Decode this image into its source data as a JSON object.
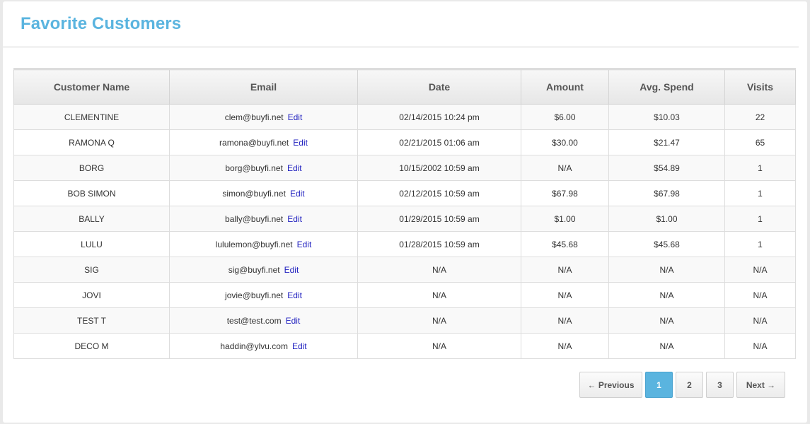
{
  "header": {
    "title": "Favorite Customers"
  },
  "table": {
    "columns": [
      "Customer Name",
      "Email",
      "Date",
      "Amount",
      "Avg. Spend",
      "Visits"
    ],
    "edit_label": "Edit",
    "rows": [
      {
        "name": "CLEMENTINE",
        "email": "clem@buyfi.net",
        "date": "02/14/2015 10:24 pm",
        "amount": "$6.00",
        "avg": "$10.03",
        "visits": "22"
      },
      {
        "name": "RAMONA Q",
        "email": "ramona@buyfi.net",
        "date": "02/21/2015 01:06 am",
        "amount": "$30.00",
        "avg": "$21.47",
        "visits": "65"
      },
      {
        "name": "BORG",
        "email": "borg@buyfi.net",
        "date": "10/15/2002 10:59 am",
        "amount": "N/A",
        "avg": "$54.89",
        "visits": "1"
      },
      {
        "name": "BOB SIMON",
        "email": "simon@buyfi.net",
        "date": "02/12/2015 10:59 am",
        "amount": "$67.98",
        "avg": "$67.98",
        "visits": "1"
      },
      {
        "name": "BALLY",
        "email": "bally@buyfi.net",
        "date": "01/29/2015 10:59 am",
        "amount": "$1.00",
        "avg": "$1.00",
        "visits": "1"
      },
      {
        "name": "LULU",
        "email": "lululemon@buyfi.net",
        "date": "01/28/2015 10:59 am",
        "amount": "$45.68",
        "avg": "$45.68",
        "visits": "1"
      },
      {
        "name": "SIG",
        "email": "sig@buyfi.net",
        "date": "N/A",
        "amount": "N/A",
        "avg": "N/A",
        "visits": "N/A"
      },
      {
        "name": "JOVI",
        "email": "jovie@buyfi.net",
        "date": "N/A",
        "amount": "N/A",
        "avg": "N/A",
        "visits": "N/A"
      },
      {
        "name": "TEST T",
        "email": "test@test.com",
        "date": "N/A",
        "amount": "N/A",
        "avg": "N/A",
        "visits": "N/A"
      },
      {
        "name": "DECO M",
        "email": "haddin@ylvu.com",
        "date": "N/A",
        "amount": "N/A",
        "avg": "N/A",
        "visits": "N/A"
      }
    ]
  },
  "pagination": {
    "previous_label": "← Previous",
    "next_label": "Next →",
    "pages": [
      "1",
      "2",
      "3"
    ],
    "current_page": "1"
  },
  "colors": {
    "accent": "#5ab4df",
    "link": "#1f1fbf"
  }
}
